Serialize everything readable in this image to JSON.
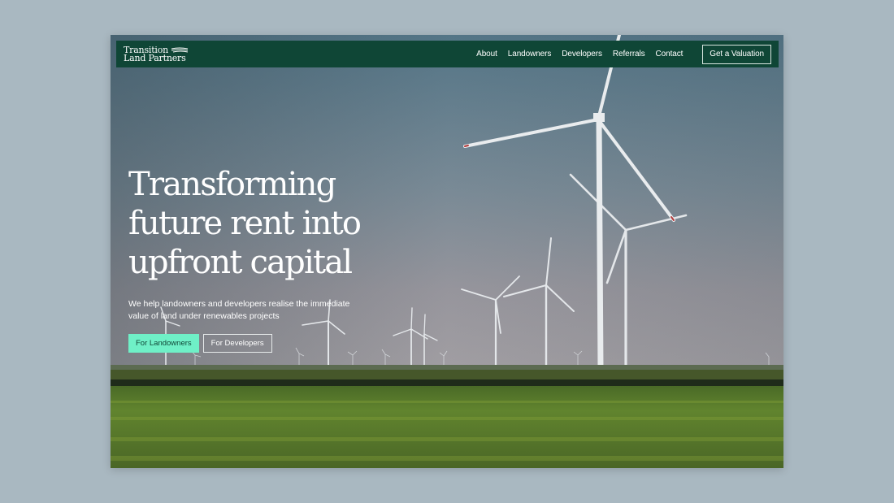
{
  "brand": {
    "line1": "Transition",
    "line2": "Land Partners",
    "icon": "wind-lines-icon"
  },
  "nav": {
    "links": [
      "About",
      "Landowners",
      "Developers",
      "Referrals",
      "Contact"
    ],
    "cta_label": "Get a Valuation"
  },
  "hero": {
    "title_lines": [
      "Transforming",
      "future rent into",
      "upfront capital"
    ],
    "subtitle": "We help landowners and developers realise the immediate value of land under renewables projects",
    "primary_button": "For Landowners",
    "secondary_button": "For Developers"
  },
  "colors": {
    "page_background": "#a9b8c1",
    "nav_background": "#0f4636",
    "primary_button": "#6ff0c7",
    "text": "#ffffff"
  }
}
